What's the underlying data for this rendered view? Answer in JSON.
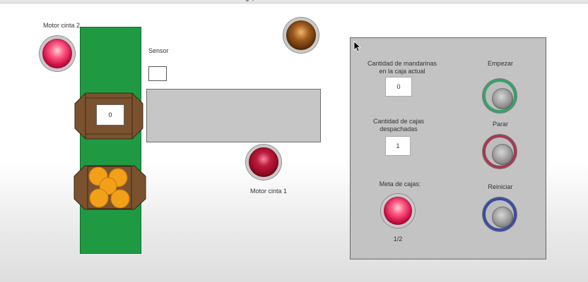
{
  "labels": {
    "motor_cinta_2": "Motor cinta 2",
    "motor_cinta_1": "Motor cinta 1",
    "sensor": "Sensor"
  },
  "conveyor": {
    "box_count_value": "0"
  },
  "panel": {
    "mandarinas_label_line1": "Cantidad de mandarinas",
    "mandarinas_label_line2": "en la caja actual",
    "mandarinas_value": "0",
    "cajas_label_line1": "Cantidad de cajas",
    "cajas_label_line2": "despachadas",
    "cajas_value": "1",
    "meta_label": "Meta de cajas:",
    "meta_value": "1/2",
    "empezar_label": "Empezar",
    "parar_label": "Parar",
    "reiniciar_label": "Reiniciar"
  },
  "colors": {
    "belt": "#1f9a43",
    "box": "#7a5230",
    "orange": "#f2a01a",
    "panel": "#c3c3c3",
    "lamp_pink": "#e8306a",
    "lamp_dark_red": "#9a0c2a",
    "lamp_brown": "#6b3a10"
  },
  "icons": {
    "cursor": "arrow-cursor-icon"
  }
}
